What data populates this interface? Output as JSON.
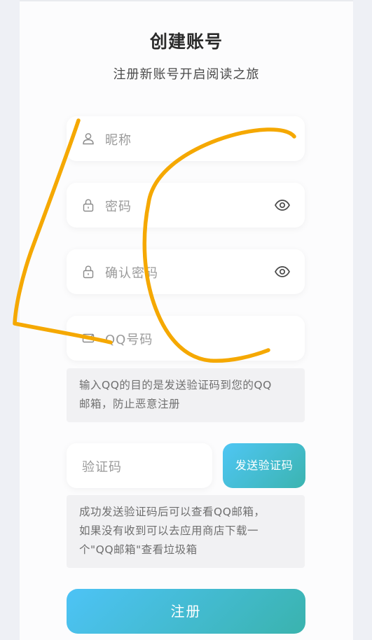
{
  "header": {
    "title": "创建账号",
    "subtitle": "注册新账号开启阅读之旅"
  },
  "form": {
    "nickname": {
      "placeholder": "昵称",
      "icon": "user-icon"
    },
    "password": {
      "placeholder": "密码",
      "icon": "lock-icon",
      "toggle_icon": "eye-icon"
    },
    "confirm_password": {
      "placeholder": "确认密码",
      "icon": "lock-icon",
      "toggle_icon": "eye-icon"
    },
    "qq_number": {
      "placeholder": "QQ号码",
      "icon": "mail-icon"
    },
    "qq_note_line1": "输入QQ的目的是发送验证码到您的QQ",
    "qq_note_line2": "邮箱，防止恶意注册",
    "verification_code": {
      "placeholder": "验证码"
    },
    "send_code_label": "发送验证码",
    "code_note_line1": "成功发送验证码后可以查看QQ邮箱，",
    "code_note_line2": "如果没有收到可以去应用商店下载一",
    "code_note_line3": "个\"QQ邮箱\"查看垃圾箱",
    "submit_label": "注册"
  },
  "colors": {
    "accent_start": "#4fc6f4",
    "accent_end": "#3bb4b0",
    "scribble": "#f5a800"
  }
}
